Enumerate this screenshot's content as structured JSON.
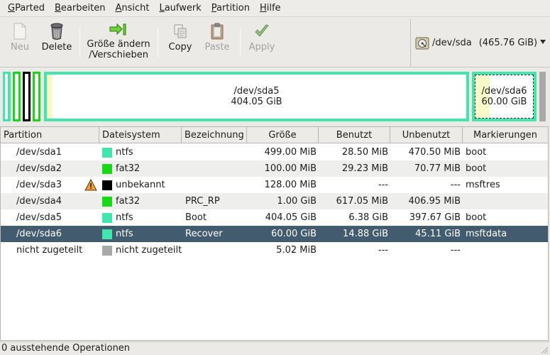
{
  "menubar": [
    {
      "mnemonic": "G",
      "rest": "Parted"
    },
    {
      "mnemonic": "B",
      "rest": "earbeiten"
    },
    {
      "mnemonic": "A",
      "rest": "nsicht"
    },
    {
      "mnemonic": "L",
      "rest": "aufwerk"
    },
    {
      "mnemonic": "P",
      "rest": "artition"
    },
    {
      "mnemonic": "H",
      "rest": "ilfe"
    }
  ],
  "toolbar": {
    "new": "Neu",
    "delete": "Delete",
    "resize_line1": "Größe ändern",
    "resize_line2": "/Verschieben",
    "copy": "Copy",
    "paste": "Paste",
    "apply": "Apply"
  },
  "device": {
    "path": "/dev/sda",
    "size": "(465.76 GiB)",
    "icon": "harddisk-icon"
  },
  "graph": {
    "sda5_name": "/dev/sda5",
    "sda5_size": "404.05 GiB",
    "sda6_name": "/dev/sda6",
    "sda6_size": "60.00 GiB"
  },
  "table": {
    "headers": [
      "Partition",
      "Dateisystem",
      "Bezeichnung",
      "Größe",
      "Benutzt",
      "Unbenutzt",
      "Markierungen"
    ],
    "rows": [
      {
        "partition": "/dev/sda1",
        "fs": "ntfs",
        "fs_color": "#42e5ac",
        "label": "",
        "size": "499.00 MiB",
        "used": "28.50 MiB",
        "unused": "470.50 MiB",
        "flags": "boot",
        "warn": false
      },
      {
        "partition": "/dev/sda2",
        "fs": "fat32",
        "fs_color": "#18d918",
        "label": "",
        "size": "100.00 MiB",
        "used": "29.23 MiB",
        "unused": "70.77 MiB",
        "flags": "boot",
        "warn": false
      },
      {
        "partition": "/dev/sda3",
        "fs": "unbekannt",
        "fs_color": "#000000",
        "label": "",
        "size": "128.00 MiB",
        "used": "---",
        "unused": "---",
        "flags": "msftres",
        "warn": true
      },
      {
        "partition": "/dev/sda4",
        "fs": "fat32",
        "fs_color": "#18d918",
        "label": "PRC_RP",
        "size": "1.00 GiB",
        "used": "617.05 MiB",
        "unused": "406.95 MiB",
        "flags": "",
        "warn": false
      },
      {
        "partition": "/dev/sda5",
        "fs": "ntfs",
        "fs_color": "#42e5ac",
        "label": "Boot",
        "size": "404.05 GiB",
        "used": "6.38 GiB",
        "unused": "397.67 GiB",
        "flags": "boot",
        "warn": false
      },
      {
        "partition": "/dev/sda6",
        "fs": "ntfs",
        "fs_color": "#42e5ac",
        "label": "Recover",
        "size": "60.00 GiB",
        "used": "14.88 GiB",
        "unused": "45.11 GiB",
        "flags": "msftdata",
        "warn": false
      },
      {
        "partition": "nicht zugeteilt",
        "fs": "nicht zugeteilt",
        "fs_color": "#a9a9a9",
        "label": "",
        "size": "5.02 MiB",
        "used": "---",
        "unused": "---",
        "flags": "",
        "warn": false
      }
    ],
    "selected_index": 5
  },
  "status": "0 ausstehende Operationen",
  "colors": {
    "ntfs": "#42e5ac",
    "fat32": "#18d918",
    "unknown": "#000000",
    "unallocated": "#a9a9a9",
    "selection": "#435b6e",
    "used_fill": "#f8f8c8"
  }
}
